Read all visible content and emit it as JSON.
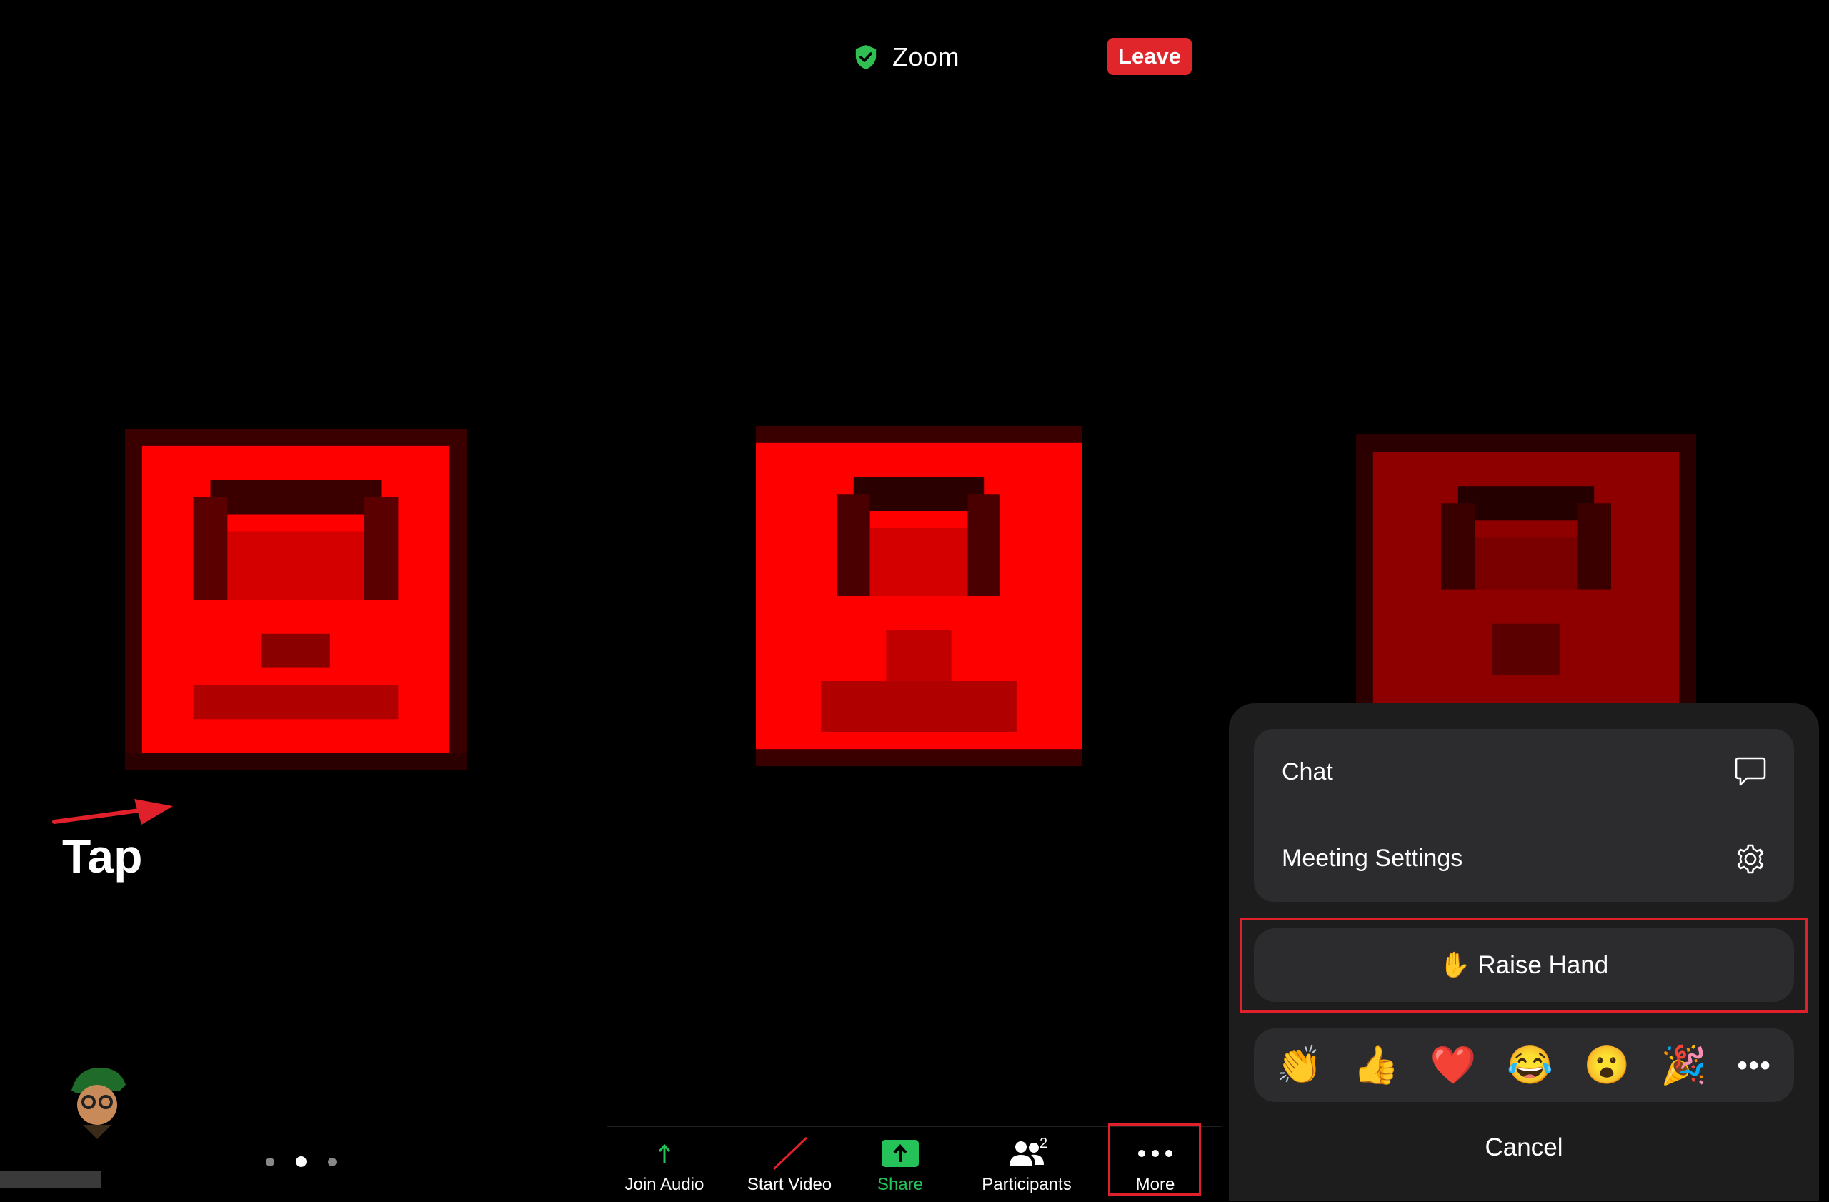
{
  "header": {
    "title": "Zoom",
    "leave_label": "Leave"
  },
  "annotation": {
    "tap_label": "Tap"
  },
  "toolbar": {
    "join_audio_label": "Join Audio",
    "start_video_label": "Start Video",
    "share_label": "Share",
    "participants_label": "Participants",
    "participants_count": "2",
    "more_label": "More"
  },
  "more_sheet": {
    "items": [
      {
        "label": "Chat",
        "icon": "chat-bubble-icon"
      },
      {
        "label": "Meeting Settings",
        "icon": "gear-icon"
      }
    ],
    "raise_hand_emoji": "✋",
    "raise_hand_label": "Raise Hand",
    "reactions": [
      "👏",
      "👍",
      "❤️",
      "😂",
      "😮",
      "🎉"
    ],
    "more_reactions": "•••",
    "cancel_label": "Cancel"
  },
  "colors": {
    "leave": "#e0262a",
    "share": "#25c25a",
    "highlight": "#e0202a",
    "tile": "#ff0000",
    "sheet": "#1d1d1d",
    "sheet_group": "#2c2c2e"
  }
}
